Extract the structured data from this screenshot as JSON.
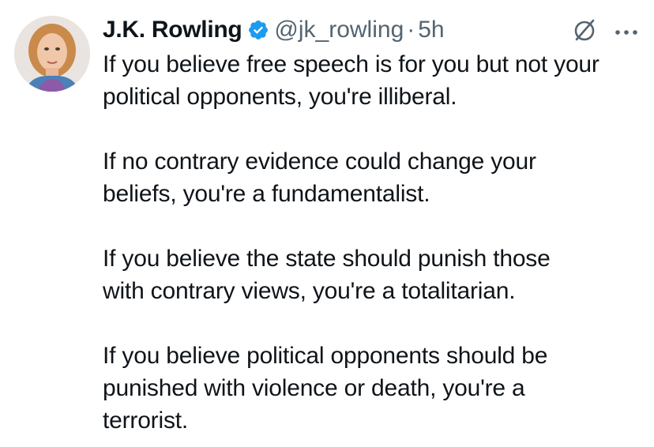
{
  "tweet": {
    "author_name": "J.K. Rowling",
    "handle": "@jk_rowling",
    "separator": "·",
    "timestamp": "5h",
    "paragraphs": [
      "If you believe free speech is for you but not your\npolitical opponents, you're illiberal.",
      "If no contrary evidence could change your\nbeliefs, you're a fundamentalist.",
      "If you believe the state should punish those\nwith contrary views, you're a totalitarian.",
      "If you believe political opponents should be\npunished with violence or death, you're a\nterrorist."
    ]
  },
  "colors": {
    "text_primary": "#0f1419",
    "text_secondary": "#536471",
    "verified_badge": "#1d9bf0"
  },
  "icons": {
    "verified": "verified-badge-icon",
    "grok": "grok-icon",
    "more": "more-options-icon"
  }
}
